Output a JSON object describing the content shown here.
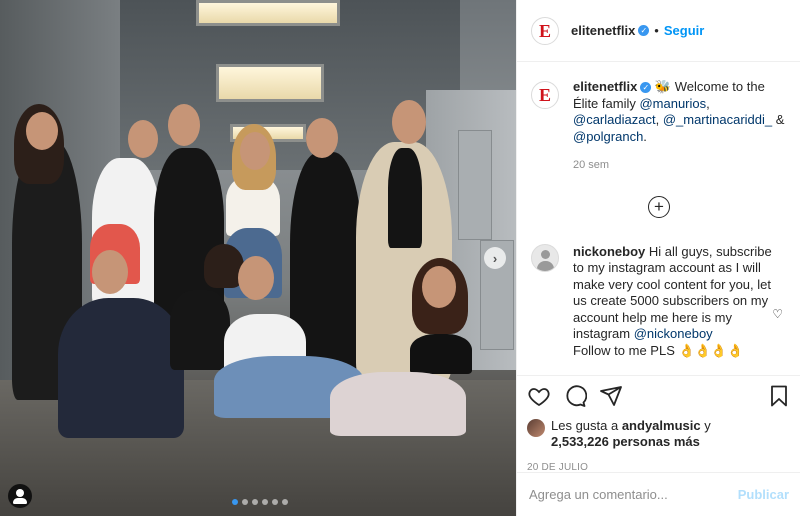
{
  "post": {
    "username": "elitenetflix",
    "avatar_logo": "E",
    "follow_label": "Seguir",
    "separator": "•",
    "verified_icon": "✓"
  },
  "caption": {
    "username": "elitenetflix",
    "emoji": "🐝",
    "text_welcome": "Welcome to the Élite family ",
    "mention_1": "@manurios",
    "comma_1": ",",
    "mention_2": "@carladiazact",
    "comma_2": ", ",
    "mention_3": "@_martinacariddi_",
    "amp": " & ",
    "mention_4": "@polgranch",
    "period": ".",
    "time": "20 sem"
  },
  "load_more_icon": "+",
  "comment": {
    "username": "nickoneboy",
    "text": "Hi all guys, subscribe to my instagram account as I will make very cool content for you, let us create 5000 subscribers on my account help me here is my instagram",
    "mention": "@nickoneboy",
    "text_end": "Follow to me PLS",
    "emojis": "👌👌👌👌",
    "like_icon": "♡"
  },
  "likes": {
    "prefix": "Les gusta a ",
    "user": "andyalmusic",
    "connector": " y",
    "count_text": "2,533,226 personas más"
  },
  "date": "20 DE JULIO",
  "add_comment": {
    "placeholder": "Agrega un comentario...",
    "publish_label": "Publicar"
  },
  "carousel": {
    "next_icon": "›",
    "slide_count": 6,
    "active_index": 0
  },
  "colors": {
    "accent": "#0095f6",
    "publish_disabled": "#b2dffc",
    "brand_red": "#d0121b"
  }
}
